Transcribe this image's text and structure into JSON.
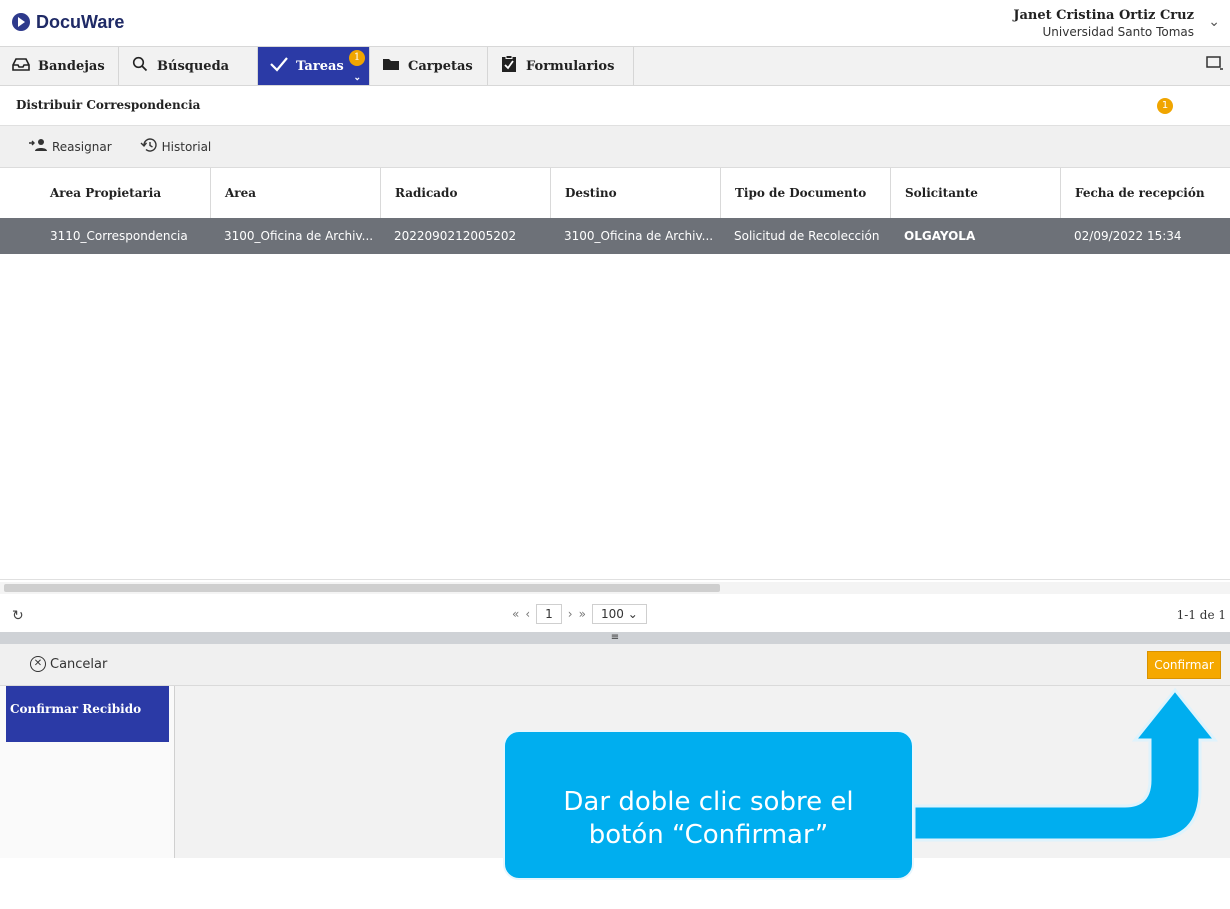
{
  "app": {
    "logo_text": "DocuWare",
    "user_name": "Janet Cristina Ortiz Cruz",
    "user_org": "Universidad Santo Tomas"
  },
  "nav": {
    "tabs": [
      {
        "label": "Bandejas",
        "icon": "tray-icon"
      },
      {
        "label": "Búsqueda",
        "icon": "search-icon"
      },
      {
        "label": "Tareas",
        "icon": "check-icon",
        "badge": "1",
        "active": true
      },
      {
        "label": "Carpetas",
        "icon": "folder-icon"
      },
      {
        "label": "Formularios",
        "icon": "clipboard-icon"
      }
    ]
  },
  "subheader": {
    "title": "Distribuir Correspondencia",
    "badge": "1"
  },
  "toolbar": {
    "reassign_label": "Reasignar",
    "history_label": "Historial"
  },
  "table": {
    "columns": [
      "Area Propietaria",
      "Area",
      "Radicado",
      "Destino",
      "Tipo de Documento",
      "Solicitante",
      "Fecha de recepción"
    ],
    "rows": [
      [
        "3110_Correspondencia",
        "3100_Oficina de Archiv...",
        "2022090212005202",
        "3100_Oficina de Archiv...",
        "Solicitud de Recolección",
        "OLGAYOLA",
        "02/09/2022 15:34"
      ]
    ]
  },
  "pager": {
    "page": "1",
    "page_size": "100",
    "count": "1-1 de 1"
  },
  "actions": {
    "cancel_label": "Cancelar",
    "confirm_label": "Confirmar"
  },
  "form": {
    "step_label": "Confirmar Recibido"
  },
  "callout": {
    "line1": "Dar doble clic sobre el",
    "line2": "botón “Confirmar”"
  },
  "colors": {
    "accent": "#2b3aa6",
    "confirm": "#f5a800",
    "callout": "#00aeef",
    "selected_row": "#6d7178"
  }
}
